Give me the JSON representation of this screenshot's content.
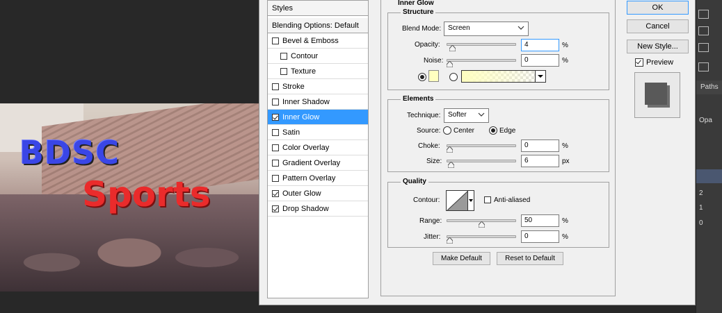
{
  "dialog": {
    "styles_header": "Styles",
    "blending_options": "Blending Options: Default",
    "style_items": [
      {
        "label": "Bevel & Emboss",
        "checked": false,
        "sub": false
      },
      {
        "label": "Contour",
        "checked": false,
        "sub": true
      },
      {
        "label": "Texture",
        "checked": false,
        "sub": true
      },
      {
        "label": "Stroke",
        "checked": false,
        "sub": false
      },
      {
        "label": "Inner Shadow",
        "checked": false,
        "sub": false
      },
      {
        "label": "Inner Glow",
        "checked": true,
        "sub": false,
        "selected": true
      },
      {
        "label": "Satin",
        "checked": false,
        "sub": false
      },
      {
        "label": "Color Overlay",
        "checked": false,
        "sub": false
      },
      {
        "label": "Gradient Overlay",
        "checked": false,
        "sub": false
      },
      {
        "label": "Pattern Overlay",
        "checked": false,
        "sub": false
      },
      {
        "label": "Outer Glow",
        "checked": true,
        "sub": false
      },
      {
        "label": "Drop Shadow",
        "checked": true,
        "sub": false
      }
    ],
    "panel_title": "Inner Glow",
    "structure": {
      "title": "Structure",
      "blend_mode_label": "Blend Mode:",
      "blend_mode_value": "Screen",
      "opacity_label": "Opacity:",
      "opacity_value": "4",
      "opacity_fraction": 0.04,
      "noise_label": "Noise:",
      "noise_value": "0",
      "noise_fraction": 0.0,
      "percent": "%",
      "glow_color": "#ffffc0"
    },
    "elements": {
      "title": "Elements",
      "technique_label": "Technique:",
      "technique_value": "Softer",
      "source_label": "Source:",
      "source_center": "Center",
      "source_edge": "Edge",
      "choke_label": "Choke:",
      "choke_value": "0",
      "choke_fraction": 0.0,
      "size_label": "Size:",
      "size_value": "6",
      "size_fraction": 0.024,
      "percent": "%",
      "px": "px"
    },
    "quality": {
      "title": "Quality",
      "contour_label": "Contour:",
      "anti_aliased_label": "Anti-aliased",
      "range_label": "Range:",
      "range_value": "50",
      "range_fraction": 0.5,
      "jitter_label": "Jitter:",
      "jitter_value": "0",
      "jitter_fraction": 0.0,
      "percent": "%"
    },
    "make_default": "Make Default",
    "reset_default": "Reset to Default",
    "ok": "OK",
    "cancel": "Cancel",
    "new_style": "New Style...",
    "preview_label": "Preview",
    "preview_checked": true
  },
  "canvas": {
    "title_text": "BDSC",
    "subtitle_text": "Sports"
  },
  "right_panel": {
    "paths_tab": "Paths",
    "opacity_short": "Opa",
    "row_values": [
      "2",
      "1",
      "0"
    ]
  },
  "colors": {
    "selection": "#3399ff",
    "dialog_bg": "#f0f0f0",
    "bdsc_blue": "#3a46e6",
    "sports_red": "#ea2b2b"
  }
}
